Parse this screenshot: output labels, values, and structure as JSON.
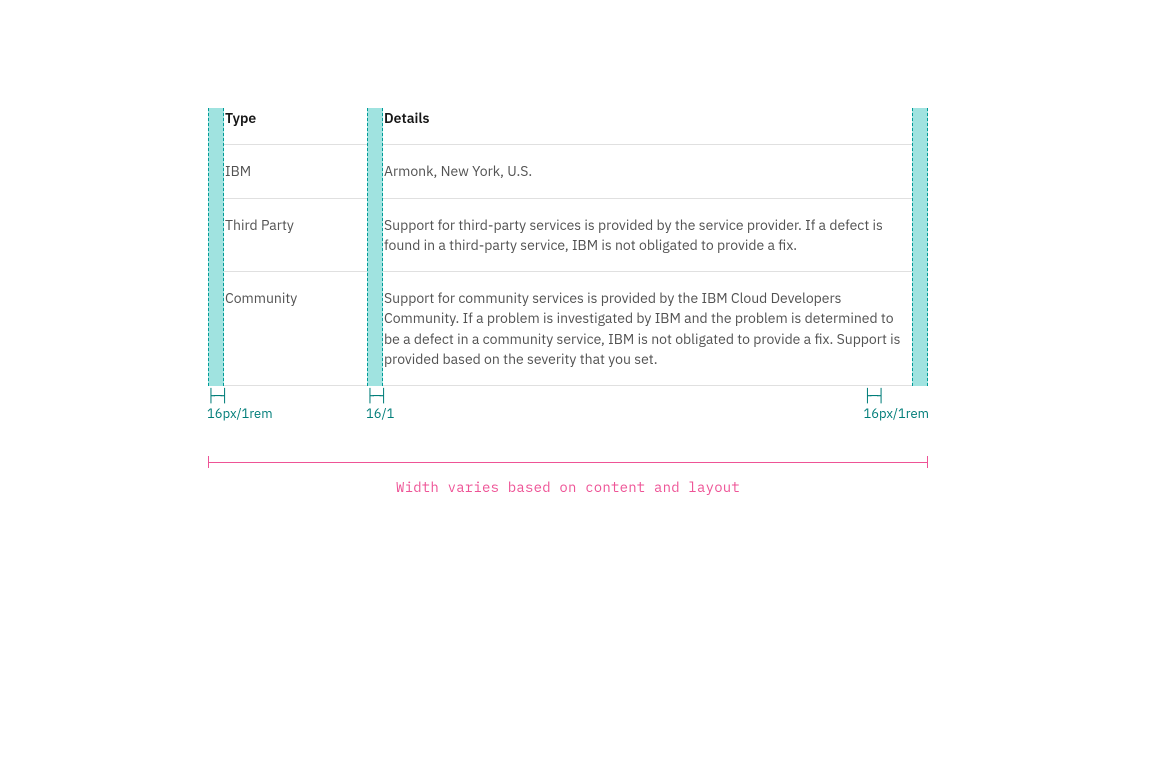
{
  "table": {
    "headers": [
      "Type",
      "Details"
    ],
    "rows": [
      {
        "type": "IBM",
        "details": "Armonk, New York, U.S."
      },
      {
        "type": "Third Party",
        "details": "Support for third-party services is provided by the service provider. If a defect is found in a third-party service, IBM is not obligated to provide a fix."
      },
      {
        "type": "Community",
        "details": "Support for community services is provided by the IBM Cloud Developers Community. If a problem is investigated by IBM and the problem is determined to be a defect in a community service, IBM is not obligated to provide a fix. Support is provided based on the severity that you set."
      }
    ]
  },
  "spec": {
    "left": "16px/1rem",
    "mid": "16/1",
    "right": "16px/1rem"
  },
  "width_caption": "Width varies based on content and layout",
  "colors": {
    "teal_fill": "#a0e3e0",
    "teal_dash": "#009c98",
    "spec_text": "#007d79",
    "pink": "#ee5396",
    "divider": "#e0e0e0",
    "body_text": "#525252",
    "header_text": "#161616"
  }
}
